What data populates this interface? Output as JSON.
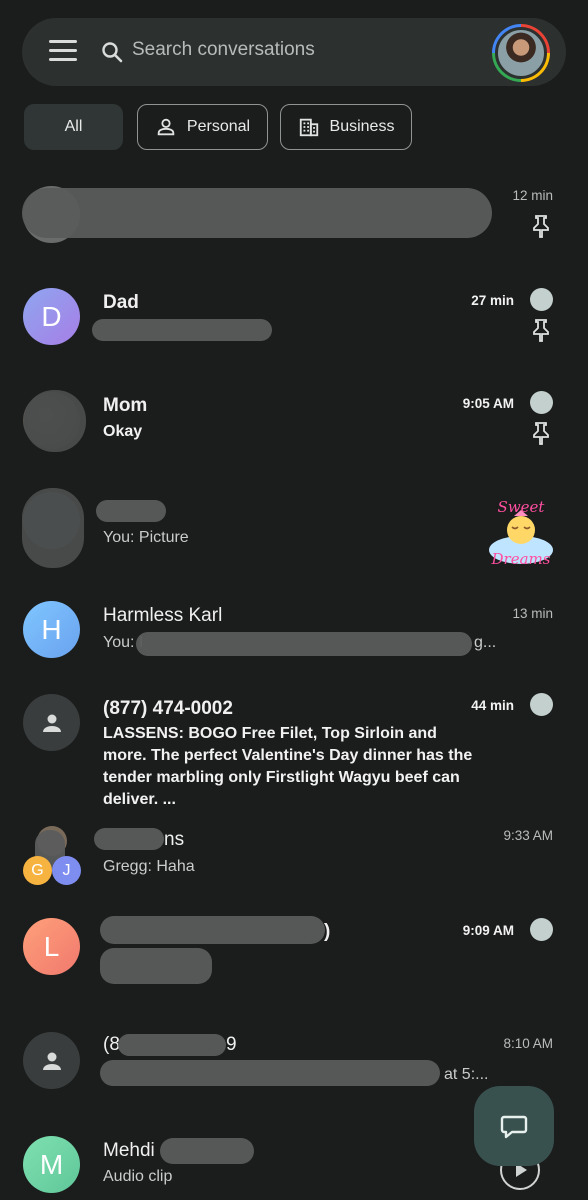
{
  "search": {
    "placeholder": "Search conversations"
  },
  "filters": [
    {
      "label": "All",
      "icon": "none",
      "active": true
    },
    {
      "label": "Personal",
      "icon": "person-icon"
    },
    {
      "label": "Business",
      "icon": "building-icon"
    }
  ],
  "conversations": [
    {
      "name": "",
      "snippet": "",
      "time": "12 min",
      "unread": false,
      "pinned": true
    },
    {
      "name": "Dad",
      "snippet": "",
      "time": "27 min",
      "unread": true,
      "pinned": true,
      "initial": "D"
    },
    {
      "name": "Mom",
      "snippet": "Okay",
      "time": "9:05 AM",
      "unread": true,
      "pinned": true
    },
    {
      "name": "",
      "snippet": "You: Picture",
      "time": "",
      "unread": false,
      "sticker_text": "Sweet Dreams"
    },
    {
      "name": "Harmless Karl",
      "snippet": "You: I",
      "snippet_tail": "g...",
      "time": "13 min",
      "unread": false,
      "initial": "H"
    },
    {
      "name": "(877) 474-0002",
      "snippet": "LASSENS: BOGO Free Filet, Top Sirloin and more. The perfect Valentine's Day dinner has the tender marbling only Firstlight Wagyu beef can deliver. ...",
      "time": "44 min",
      "unread": true
    },
    {
      "name": "",
      "name_tail": "ns",
      "snippet": "Gregg: Haha",
      "time": "9:33 AM",
      "unread": false,
      "group_initials": [
        "G",
        "J"
      ]
    },
    {
      "name": "",
      "name_tail": ")",
      "snippet": "",
      "time": "9:09 AM",
      "unread": true,
      "initial": "L"
    },
    {
      "name": "(8",
      "name_tail": "9",
      "snippet": "",
      "snippet_tail": "at 5:...",
      "time": "8:10 AM",
      "unread": false
    },
    {
      "name": "Mehdi",
      "snippet": "Audio clip",
      "time": "",
      "unread": false,
      "initial": "M"
    }
  ],
  "colors": {
    "background": "#1b1c1c",
    "search_bar": "#2c302f",
    "unread_dot": "#c3d0ce",
    "fab": "#38514f"
  }
}
